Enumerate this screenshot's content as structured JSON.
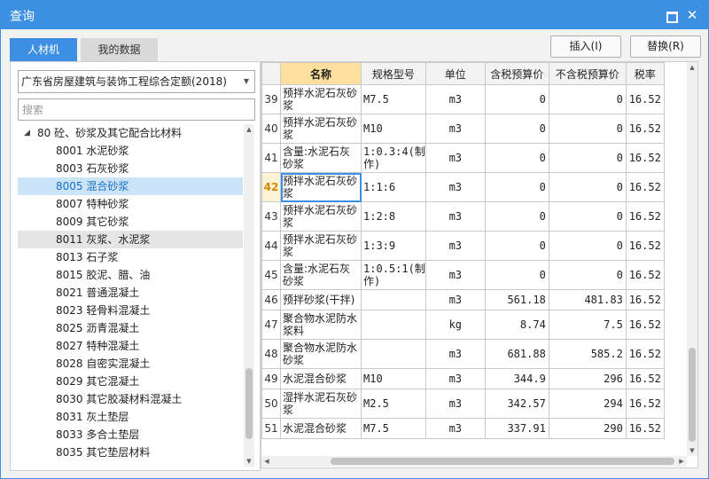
{
  "window": {
    "title": "查询"
  },
  "titlebar_icons": {
    "maximize": "maximize-icon",
    "close": "close-icon",
    "close_glyph": "✕"
  },
  "tabs": [
    {
      "label": "人材机",
      "active": true
    },
    {
      "label": "我的数据",
      "active": false
    }
  ],
  "toolbar": {
    "insert_label": "插入(I)",
    "replace_label": "替换(R)"
  },
  "left": {
    "quota_select": "广东省房屋建筑与装饰工程综合定额(2018)",
    "search_placeholder": "搜索",
    "tree": [
      {
        "label": "80 砼、砂浆及其它配合比材料",
        "level": 1,
        "expanded": true
      },
      {
        "label": "8001 水泥砂浆",
        "level": 2
      },
      {
        "label": "8003 石灰砂浆",
        "level": 2
      },
      {
        "label": "8005 混合砂浆",
        "level": 2,
        "selected": true
      },
      {
        "label": "8007 特种砂浆",
        "level": 2
      },
      {
        "label": "8009 其它砂浆",
        "level": 2
      },
      {
        "label": "8011 灰浆、水泥浆",
        "level": 2,
        "hover": true
      },
      {
        "label": "8013 石子浆",
        "level": 2
      },
      {
        "label": "8015 胶泥、腊、油",
        "level": 2
      },
      {
        "label": "8021 普通混凝土",
        "level": 2
      },
      {
        "label": "8023 轻骨料混凝土",
        "level": 2
      },
      {
        "label": "8025 沥青混凝土",
        "level": 2
      },
      {
        "label": "8027 特种混凝土",
        "level": 2
      },
      {
        "label": "8028 自密实混凝土",
        "level": 2
      },
      {
        "label": "8029 其它混凝土",
        "level": 2
      },
      {
        "label": "8030 其它胶凝材料混凝土",
        "level": 2
      },
      {
        "label": "8031 灰土垫层",
        "level": 2
      },
      {
        "label": "8033 多合土垫层",
        "level": 2
      },
      {
        "label": "8035 其它垫层材料",
        "level": 2
      }
    ]
  },
  "grid": {
    "headers": [
      "",
      "名称",
      "规格型号",
      "单位",
      "含税预算价",
      "不含税预算价",
      "税率"
    ],
    "rows": [
      {
        "no": "39",
        "name": "预拌水泥石灰砂浆",
        "spec": "M7.5",
        "unit": "m3",
        "price_tax": "0",
        "price_notax": "0",
        "rate": "16.52"
      },
      {
        "no": "40",
        "name": "预拌水泥石灰砂浆",
        "spec": "M10",
        "unit": "m3",
        "price_tax": "0",
        "price_notax": "0",
        "rate": "16.52"
      },
      {
        "no": "41",
        "name": "含量:水泥石灰砂浆",
        "spec": "1:0.3:4(制作)",
        "unit": "m3",
        "price_tax": "0",
        "price_notax": "0",
        "rate": "16.52"
      },
      {
        "no": "42",
        "name": "预拌水泥石灰砂浆",
        "spec": "1:1:6",
        "unit": "m3",
        "price_tax": "0",
        "price_notax": "0",
        "rate": "16.52",
        "active": true
      },
      {
        "no": "43",
        "name": "预拌水泥石灰砂浆",
        "spec": "1:2:8",
        "unit": "m3",
        "price_tax": "0",
        "price_notax": "0",
        "rate": "16.52"
      },
      {
        "no": "44",
        "name": "预拌水泥石灰砂浆",
        "spec": "1:3:9",
        "unit": "m3",
        "price_tax": "0",
        "price_notax": "0",
        "rate": "16.52"
      },
      {
        "no": "45",
        "name": "含量:水泥石灰砂浆",
        "spec": "1:0.5:1(制作)",
        "unit": "m3",
        "price_tax": "0",
        "price_notax": "0",
        "rate": "16.52"
      },
      {
        "no": "46",
        "name": "预拌砂浆(干拌)",
        "spec": "",
        "unit": "m3",
        "price_tax": "561.18",
        "price_notax": "481.83",
        "rate": "16.52"
      },
      {
        "no": "47",
        "name": "聚合物水泥防水浆料",
        "spec": "",
        "unit": "kg",
        "price_tax": "8.74",
        "price_notax": "7.5",
        "rate": "16.52"
      },
      {
        "no": "48",
        "name": "聚合物水泥防水砂浆",
        "spec": "",
        "unit": "m3",
        "price_tax": "681.88",
        "price_notax": "585.2",
        "rate": "16.52"
      },
      {
        "no": "49",
        "name": "水泥混合砂浆",
        "spec": "M10",
        "unit": "m3",
        "price_tax": "344.9",
        "price_notax": "296",
        "rate": "16.52"
      },
      {
        "no": "50",
        "name": "湿拌水泥石灰砂浆",
        "spec": "M2.5",
        "unit": "m3",
        "price_tax": "342.57",
        "price_notax": "294",
        "rate": "16.52"
      },
      {
        "no": "51",
        "name": "水泥混合砂浆",
        "spec": "M7.5",
        "unit": "m3",
        "price_tax": "337.91",
        "price_notax": "290",
        "rate": "16.52"
      }
    ]
  },
  "colors": {
    "accent": "#3d8fe3",
    "name_header": "#ffdf9e",
    "selected_tree": "#cce4f7"
  }
}
